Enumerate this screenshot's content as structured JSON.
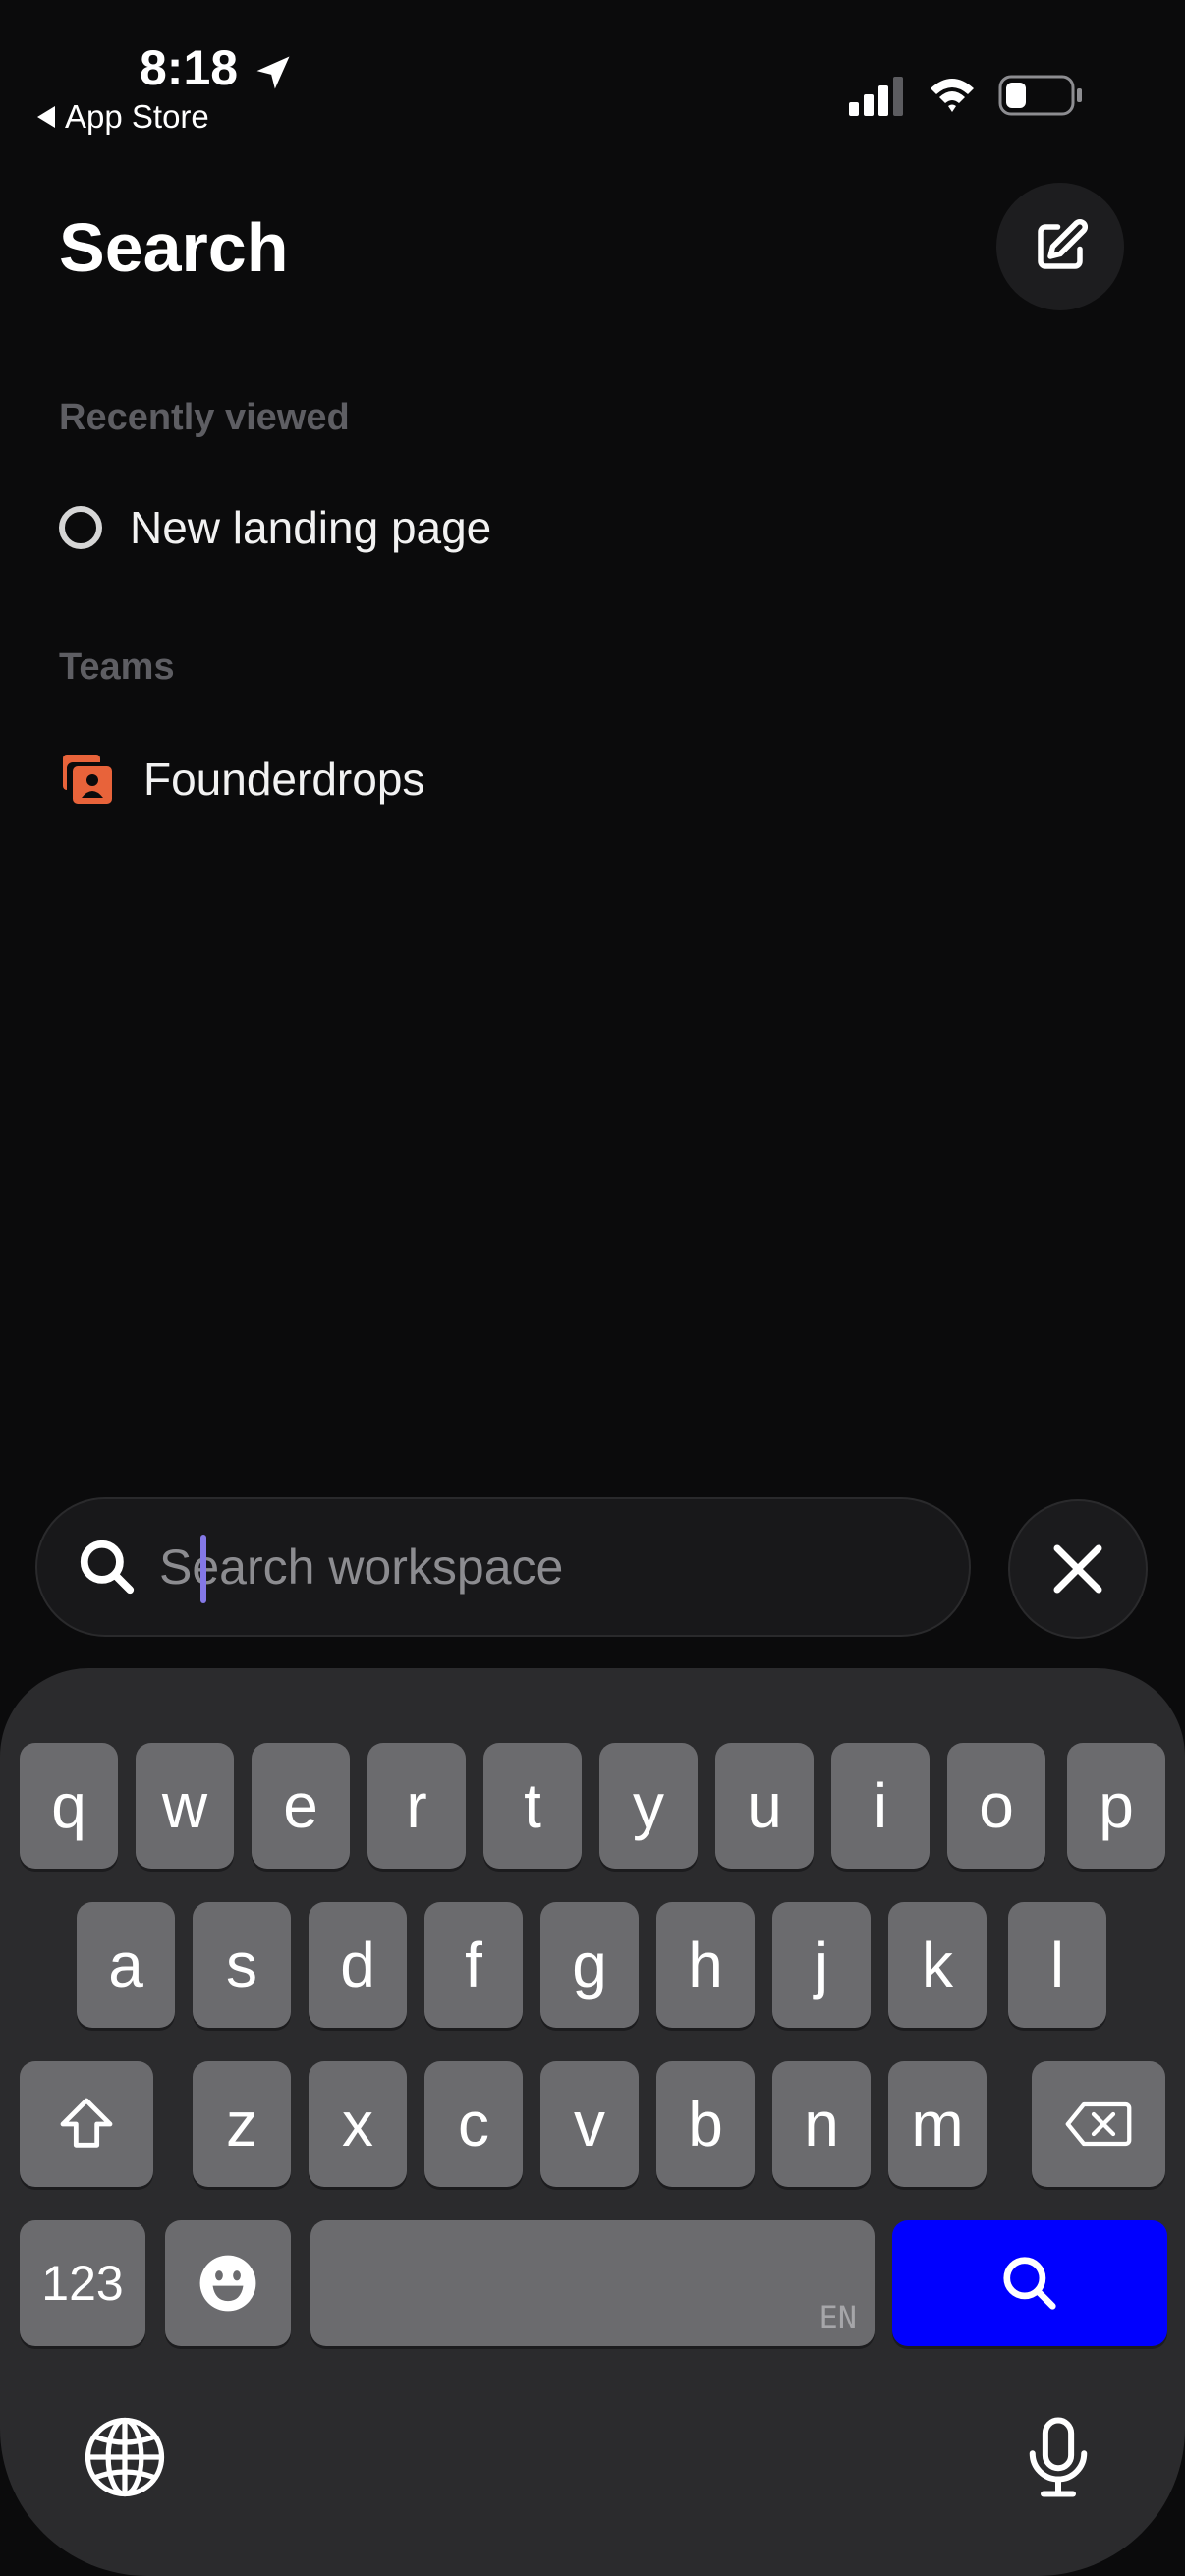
{
  "status_bar": {
    "time": "8:18",
    "back_label": "App Store"
  },
  "header": {
    "title": "Search"
  },
  "recently_viewed": {
    "label": "Recently viewed",
    "items": [
      {
        "label": "New landing page"
      }
    ]
  },
  "teams": {
    "label": "Teams",
    "items": [
      {
        "label": "Founderdrops"
      }
    ]
  },
  "search": {
    "placeholder": "Search workspace",
    "value": ""
  },
  "keyboard": {
    "row1": [
      "q",
      "w",
      "e",
      "r",
      "t",
      "y",
      "u",
      "i",
      "o",
      "p"
    ],
    "row2": [
      "a",
      "s",
      "d",
      "f",
      "g",
      "h",
      "j",
      "k",
      "l"
    ],
    "row3": [
      "z",
      "x",
      "c",
      "v",
      "b",
      "n",
      "m"
    ],
    "numbers_label": "123",
    "space_lang": "EN"
  },
  "colors": {
    "background": "#0b0b0c",
    "accent_search_key": "#0000ff",
    "team_icon": "#e8633a",
    "caret": "#8478e6"
  },
  "icons": {
    "compose": "compose-icon",
    "search": "search-icon",
    "close": "close-icon",
    "shift": "shift-icon",
    "delete": "delete-icon",
    "emoji": "emoji-icon",
    "globe": "globe-icon",
    "mic": "microphone-icon"
  }
}
